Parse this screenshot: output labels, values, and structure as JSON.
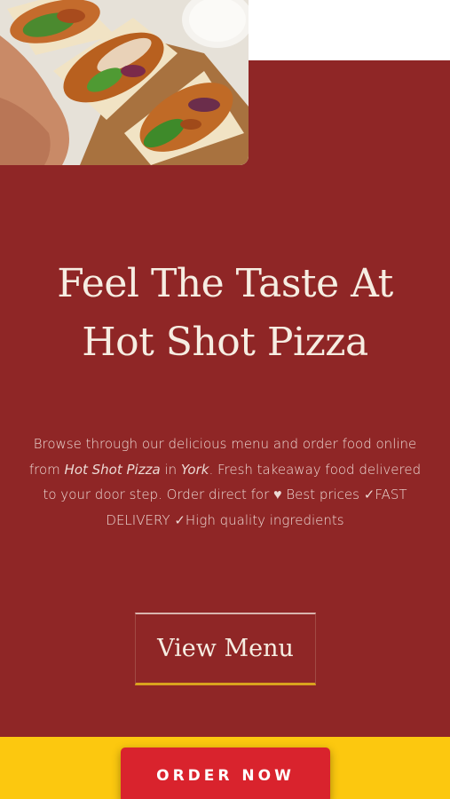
{
  "hero": {
    "image_alt": "Chicken wraps",
    "headline_line1": "Feel The Taste At",
    "headline_line2": "Hot Shot Pizza",
    "intro": {
      "part1": "Browse through our delicious menu and order food online from ",
      "restaurant": "Hot Shot Pizza",
      "part2": " in ",
      "city": "York",
      "part3": ". Fresh takeaway food delivered to your door step. Order direct for ",
      "heart": "♥",
      "part4": " Best prices  ✓FAST DELIVERY  ✓High quality ingredients"
    },
    "view_menu_label": "View Menu"
  },
  "order_bar": {
    "button_label": "ORDER NOW"
  },
  "colors": {
    "hero_background": "#8f2626",
    "order_bar_background": "#fcc80f",
    "order_button": "#d9232d",
    "view_menu_underline": "#d9a21e"
  }
}
